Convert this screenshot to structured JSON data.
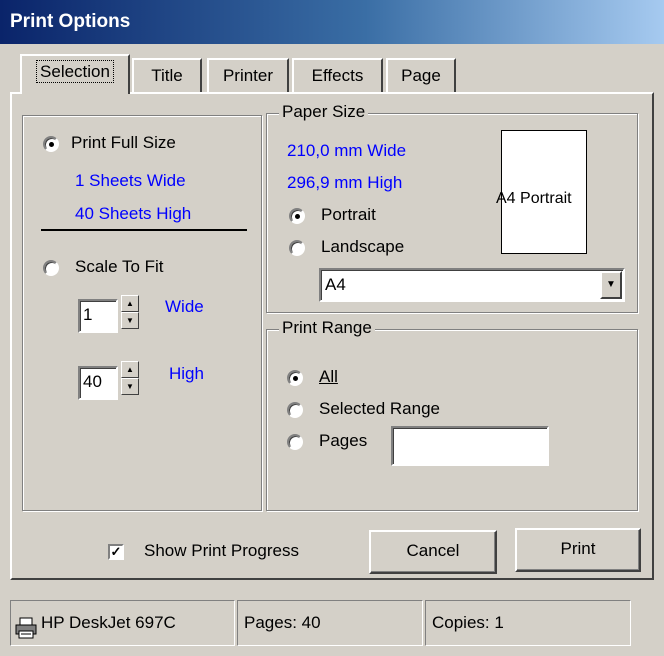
{
  "window": {
    "title": "Print Options"
  },
  "tabs": [
    "Selection",
    "Title",
    "Printer",
    "Effects",
    "Page"
  ],
  "selection": {
    "full_size_label": "Print Full Size",
    "full_size_underline": "F",
    "sheets_wide": "1 Sheets Wide",
    "sheets_high": "40 Sheets High",
    "scale_label": "Scale To Fit",
    "wide_value": "1",
    "wide_label": "Wide",
    "high_value": "40",
    "high_label": "High"
  },
  "paper_size": {
    "legend": "Paper Size",
    "width": "210,0 mm Wide",
    "height": "296,9 mm High",
    "portrait_label": "Portrait",
    "landscape_label": "Landscape",
    "preview_label": "A4 Portrait",
    "selected_size": "A4"
  },
  "print_range": {
    "legend": "Print Range",
    "all_label": "All",
    "selected_range_label": "Selected Range",
    "pages_label": "Pages",
    "pages_value": ""
  },
  "footer": {
    "show_progress_label": "Show Print Progress",
    "show_progress_checked": true,
    "cancel_label": "Cancel",
    "print_label": "Print"
  },
  "status": {
    "printer": "HP DeskJet 697C",
    "pages": "Pages: 40",
    "copies": "Copies: 1"
  }
}
